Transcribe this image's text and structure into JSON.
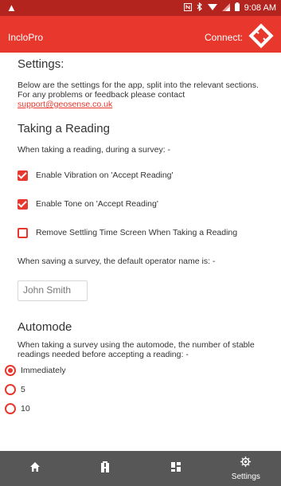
{
  "status_bar": {
    "time": "9:08 AM",
    "alert_glyph": "▲"
  },
  "header": {
    "title": "IncloPro",
    "connect_label": "Connect:"
  },
  "settings": {
    "heading": "Settings:",
    "intro": "Below are the settings for the app, split into the relevant sections. For any problems or feedback please contact",
    "contact_email": "support@geosense.co.uk"
  },
  "taking_reading": {
    "title": "Taking a Reading",
    "subtitle": "When taking a reading, during a survey: -",
    "options": [
      {
        "label": "Enable Vibration on 'Accept Reading'",
        "checked": true
      },
      {
        "label": "Enable Tone on 'Accept Reading'",
        "checked": true
      },
      {
        "label": "Remove Settling Time Screen When Taking a Reading",
        "checked": false
      }
    ],
    "operator_prompt": "When saving a survey, the default operator name is: -",
    "operator_name": "John Smith"
  },
  "automode": {
    "title": "Automode",
    "description": "When taking a survey using the automode, the number of stable readings needed before accepting a reading: -",
    "options": [
      {
        "label": "Immediately",
        "selected": true
      },
      {
        "label": "5",
        "selected": false
      },
      {
        "label": "10",
        "selected": false
      }
    ]
  },
  "bottom_nav": {
    "items": [
      {
        "icon": "home-icon",
        "label": ""
      },
      {
        "icon": "probe-icon",
        "label": ""
      },
      {
        "icon": "dashboard-icon",
        "label": ""
      },
      {
        "icon": "gear-icon",
        "label": "Settings"
      }
    ]
  },
  "colors": {
    "accent": "#e8382e",
    "status_bar": "#b3241e",
    "nav_bg": "#575757"
  }
}
